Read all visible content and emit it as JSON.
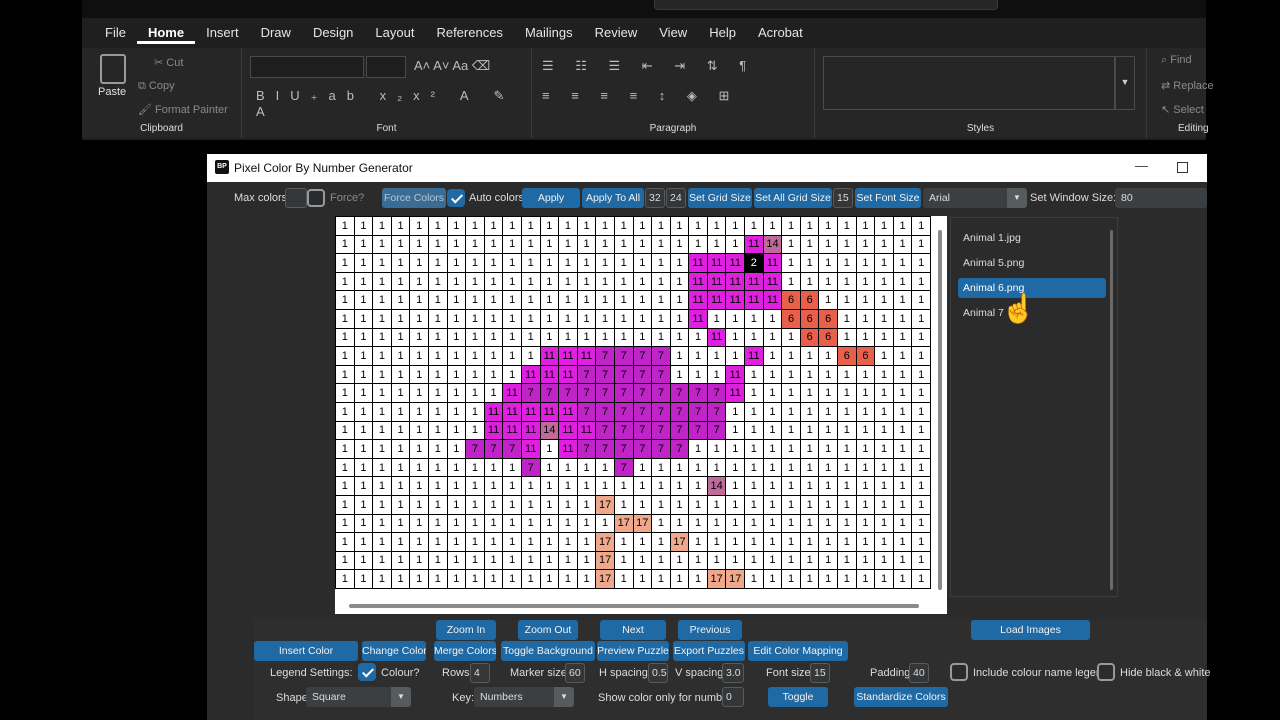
{
  "word": {
    "tabs": [
      "File",
      "Home",
      "Insert",
      "Draw",
      "Design",
      "Layout",
      "References",
      "Mailings",
      "Review",
      "View",
      "Help",
      "Acrobat"
    ],
    "active_tab": "Home",
    "clipboard": {
      "paste": "Paste",
      "cut": "Cut",
      "copy": "Copy",
      "format_painter": "Format Painter",
      "label": "Clipboard"
    },
    "font_label": "Font",
    "paragraph_label": "Paragraph",
    "styles_label": "Styles",
    "editing": {
      "find": "Find",
      "replace": "Replace",
      "select": "Select",
      "label": "Editing"
    }
  },
  "app": {
    "title": "Pixel Color By Number Generator",
    "logo": "BP",
    "toolbar": {
      "max_colors": "Max colors:",
      "force_q": "Force?",
      "force_colors": "Force Colors",
      "auto_colors": "Auto colors",
      "apply": "Apply",
      "apply_all": "Apply To All",
      "grid_w": "32",
      "grid_h": "24",
      "set_grid": "Set Grid Size",
      "set_all_grid": "Set All Grid Size",
      "font_size": "15",
      "set_font": "Set Font Size",
      "font": "Arial",
      "set_window": "Set Window Size:",
      "window_size": "80"
    },
    "files": [
      "Animal 1.jpg",
      "Animal 5.png",
      "Animal 6.png",
      "Animal 7"
    ],
    "selected_file": "Animal 6.png",
    "buttons": {
      "zoom_in": "Zoom In",
      "zoom_out": "Zoom Out",
      "next": "Next",
      "previous": "Previous",
      "load_images": "Load Images",
      "insert_color": "Insert Color",
      "change_color": "Change Color",
      "merge_colors": "Merge Colors",
      "toggle_background": "Toggle Background",
      "preview_puzzle": "Preview Puzzle",
      "export_puzzles": "Export Puzzles",
      "edit_color_mapping": "Edit Color Mapping",
      "toggle": "Toggle",
      "standardize": "Standardize Colors"
    },
    "legend": {
      "legend_settings": "Legend Settings:",
      "colour_q": "Colour?",
      "rows_label": "Rows:",
      "rows": "4",
      "marker_label": "Marker size:",
      "marker": "60",
      "hspacing_label": "H spacing:",
      "hspacing": "0.5",
      "vspacing_label": "V spacing:",
      "vspacing": "3.0",
      "fontsize_label": "Font size:",
      "fontsize": "15",
      "padding_label": "Padding:",
      "padding": "40",
      "include_legend": "Include colour name legend?",
      "hide_bw": "Hide black & white",
      "shape_label": "Shape:",
      "shape": "Square",
      "key_label": "Key:",
      "key": "Numbers",
      "show_only_label": "Show color only for number:",
      "show_only": "0"
    }
  },
  "colors": {
    "1": "#ffffff",
    "2": "#000000",
    "6": "#e8604c",
    "7": "#c023c8",
    "11": "#e020e0",
    "14": "#c06a9c",
    "17": "#f0a88c"
  },
  "grid": [
    "1111111111111111111111111111111",
    "1111111111111111111111B?11111111",
    "1111111111111111111BBB2B1111111",
    "1111111111111111111BBBBB1111111",
    "1111111111111111111BBBBB6611111",
    "1111111111111111111B11116661111",
    "11111111111111111111B111166111",
    "11111111111BBB77771111B111166111",
    "1111111111BBB77777111B1111111111",
    "111111111B77777777777B1111111111",
    "11111111BBBBB77777777111111111111",
    "11111111BBB?BB7777777111111111111",
    "1111111777B1B777777111111111111",
    "11111111117111171111111111111111",
    "11111111111111111111?111111111111",
    "11111111111111H11111111111111111",
    "111111111111111HH1111111111111111",
    "11111111111111H111H111111111111",
    "11111111111111H11111111111111111",
    "11111111111111H11111HH11111111111"
  ]
}
